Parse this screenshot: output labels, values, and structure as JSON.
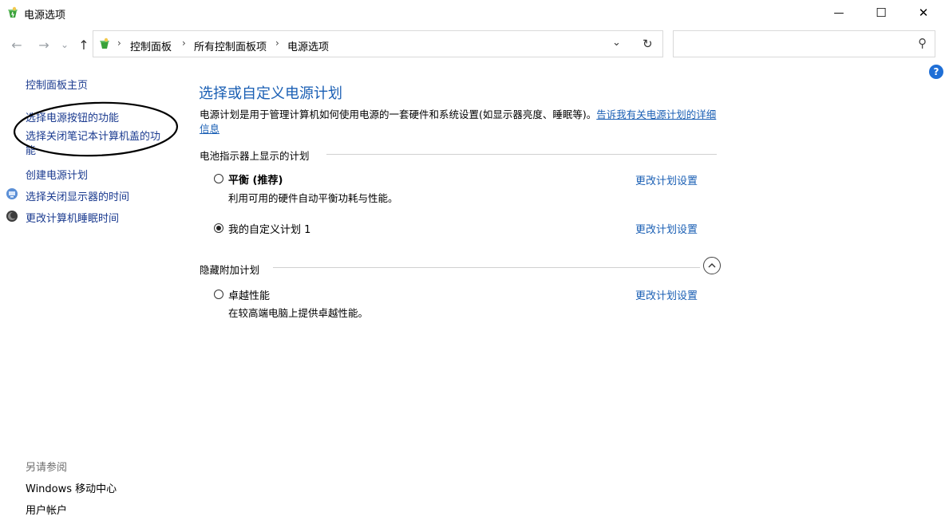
{
  "window": {
    "title": "电源选项",
    "minimize_glyph": "—",
    "maximize_glyph": "☐",
    "close_glyph": "✕"
  },
  "address": {
    "back_glyph": "←",
    "forward_glyph": "→",
    "recent_glyph": "⌄",
    "up_glyph": "↑",
    "breadcrumbs": [
      "控制面板",
      "所有控制面板项",
      "电源选项"
    ],
    "separator": "›",
    "dropdown_glyph": "⌄",
    "refresh_glyph": "↻",
    "search_placeholder": "",
    "search_glyph": "⚲"
  },
  "help": {
    "glyph": "?"
  },
  "sidebar": {
    "home": "控制面板主页",
    "links": [
      "选择电源按钮的功能",
      "选择关闭笔记本计算机盖的功能",
      "创建电源计划",
      "选择关闭显示器的时间",
      "更改计算机睡眠时间"
    ],
    "see_also_title": "另请参阅",
    "see_also": [
      "Windows 移动中心",
      "用户帐户"
    ]
  },
  "main": {
    "heading": "选择或自定义电源计划",
    "description": "电源计划是用于管理计算机如何使用电源的一套硬件和系统设置(如显示器亮度、睡眠等)。",
    "description_link": "告诉我有关电源计划的详细信息",
    "section_battery": "电池指示器上显示的计划",
    "section_hidden": "隐藏附加计划",
    "plans": [
      {
        "name": "平衡 (推荐)",
        "desc": "利用可用的硬件自动平衡功耗与性能。",
        "selected": false,
        "change": "更改计划设置"
      },
      {
        "name": "我的自定义计划 1",
        "desc": "",
        "selected": true,
        "change": "更改计划设置"
      },
      {
        "name": "卓越性能",
        "desc": "在较高端电脑上提供卓越性能。",
        "selected": false,
        "change": "更改计划设置"
      }
    ]
  },
  "colors": {
    "link": "#1a5fb4",
    "nav_link": "#1a3a8f",
    "annotation": "#000000"
  }
}
